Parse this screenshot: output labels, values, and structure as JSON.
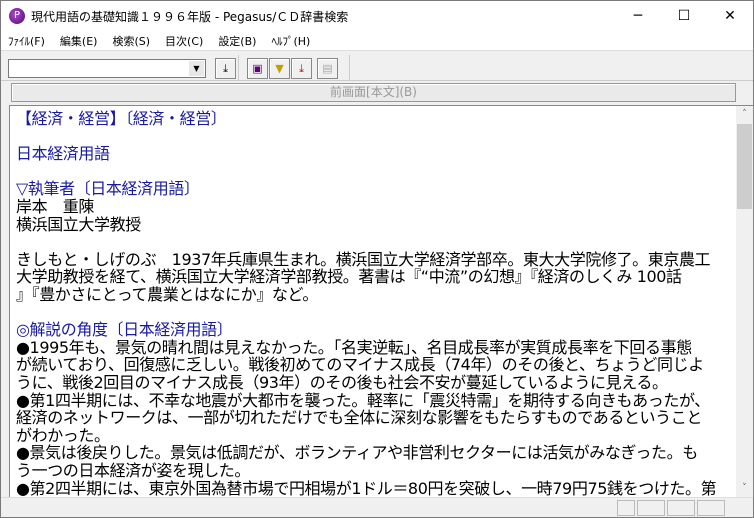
{
  "window": {
    "title": "現代用語の基礎知識１９９６年版 - Pegasus/ＣＤ辞書検索",
    "minimize": "─",
    "maximize": "☐",
    "close": "✕"
  },
  "menu": [
    "ﾌｧｲﾙ(F)",
    "編集(E)",
    "検索(S)",
    "目次(C)",
    "設定(B)",
    "ﾍﾙﾌﾟ(H)"
  ],
  "toolbar": {
    "search_value": "",
    "dropdown": "▼",
    "buttons": [
      "⤓",
      "▣",
      "▼",
      "⤓",
      "▤"
    ]
  },
  "back_button": "前画面[本文](B)",
  "content": {
    "lines": [
      {
        "text": "【経済・経営】〔経済・経営〕",
        "blue": true
      },
      {
        "text": "",
        "blue": false
      },
      {
        "text": "日本経済用語",
        "blue": true
      },
      {
        "text": "",
        "blue": false
      },
      {
        "text": "▽執筆者〔日本経済用語〕",
        "blue": true
      },
      {
        "text": "岸本　重陳",
        "blue": false
      },
      {
        "text": "横浜国立大学教授",
        "blue": false
      },
      {
        "text": "",
        "blue": false
      },
      {
        "text": "きしもと・しげのぶ　1937年兵庫県生まれ。横浜国立大学経済学部卒。東大大学院修了。東京農工",
        "blue": false
      },
      {
        "text": "大学助教授を経て、横浜国立大学経済学部教授。著書は『“中流”の幻想』『経済のしくみ 100話",
        "blue": false
      },
      {
        "text": "』『豊かさにとって農業とはなにか』など。",
        "blue": false
      },
      {
        "text": "",
        "blue": false
      },
      {
        "text": "◎解説の角度〔日本経済用語〕",
        "blue": true
      },
      {
        "text": "●1995年も、景気の晴れ間は見えなかった。「名実逆転」、名目成長率が実質成長率を下回る事態",
        "blue": false
      },
      {
        "text": "が続いており、回復感に乏しい。戦後初めてのマイナス成長（74年）のその後と、ちょうど同じよ",
        "blue": false
      },
      {
        "text": "うに、戦後2回目のマイナス成長（93年）のその後も社会不安が蔓延しているように見える。",
        "blue": false
      },
      {
        "text": "●第1四半期には、不幸な地震が大都市を襲った。軽率に「震災特需」を期待する向きもあったが、",
        "blue": false
      },
      {
        "text": "経済のネットワークは、一部が切れただけでも全体に深刻な影響をもたらすものであるということ",
        "blue": false
      },
      {
        "text": "がわかった。",
        "blue": false
      },
      {
        "text": "●景気は後戻りした。景気は低調だが、ボランティアや非営利セクターには活気がみなぎった。も",
        "blue": false
      },
      {
        "text": "う一つの日本経済が姿を現した。",
        "blue": false
      },
      {
        "text": "●第2四半期には、東京外国為替市場で円相場が1ドル＝80円を突破し、一時79円75銭をつけた。第",
        "blue": false
      }
    ]
  },
  "scroll": {
    "position_fraction": 0.0,
    "up": "˄",
    "down": "˅"
  }
}
